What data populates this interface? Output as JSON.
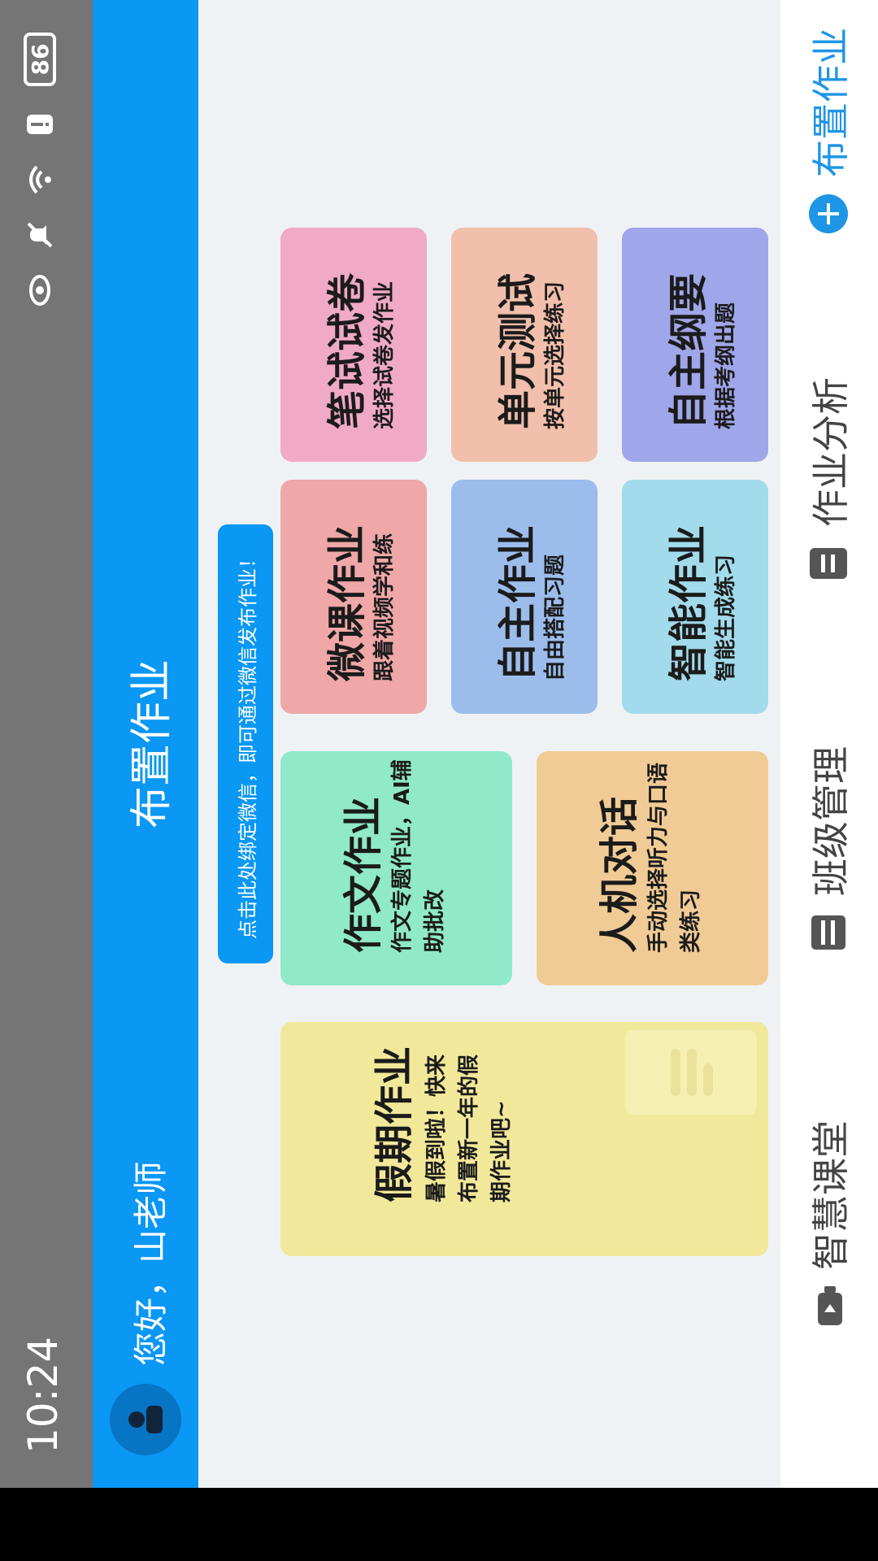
{
  "status": {
    "time": "10:24",
    "battery": "86",
    "icons": [
      "eye-icon",
      "mute-icon",
      "wifi-icon",
      "alert-icon",
      "battery-icon"
    ]
  },
  "header": {
    "greeting": "您好，山老师",
    "title": "布置作业"
  },
  "notice": "点击此处绑定微信，即可通过微信发布作业！",
  "cards": {
    "holiday": {
      "title": "假期作业",
      "desc": "暑假到啦！快来布置新一年的假期作业吧~",
      "color": "#f2e89a"
    },
    "essay": {
      "title": "作文作业",
      "desc": "作文专题作业，AI辅助批改",
      "color": "#90e9c8"
    },
    "dialogue": {
      "title": "人机对话",
      "desc": "手动选择听力与口语类练习",
      "color": "#f1cb96"
    },
    "microclass": {
      "title": "微课作业",
      "desc": "跟着视频学和练",
      "color": "#efa7a8"
    },
    "custom": {
      "title": "自主作业",
      "desc": "自由搭配习题",
      "color": "#9cbdec"
    },
    "smart": {
      "title": "智能作业",
      "desc": "智能生成练习",
      "color": "#a2dbeb"
    },
    "paper": {
      "title": "笔试试卷",
      "desc": "选择试卷发作业",
      "color": "#f0aac5"
    },
    "unit": {
      "title": "单元测试",
      "desc": "按单元选择练习",
      "color": "#f1bfab"
    },
    "outline": {
      "title": "自主纲要",
      "desc": "根据考纲出题",
      "color": "#9fa6e9"
    }
  },
  "nav": {
    "items": [
      {
        "label": "智慧课堂",
        "icon": "camera-icon"
      },
      {
        "label": "班级管理",
        "icon": "class-icon"
      },
      {
        "label": "作业分析",
        "icon": "report-icon"
      },
      {
        "label": "布置作业",
        "icon": "plus-circle-icon"
      }
    ]
  },
  "colors": {
    "accent": "#0b97f4",
    "status_bar": "#757575",
    "background": "#eff2f5",
    "nav_active": "#1f95e6"
  }
}
